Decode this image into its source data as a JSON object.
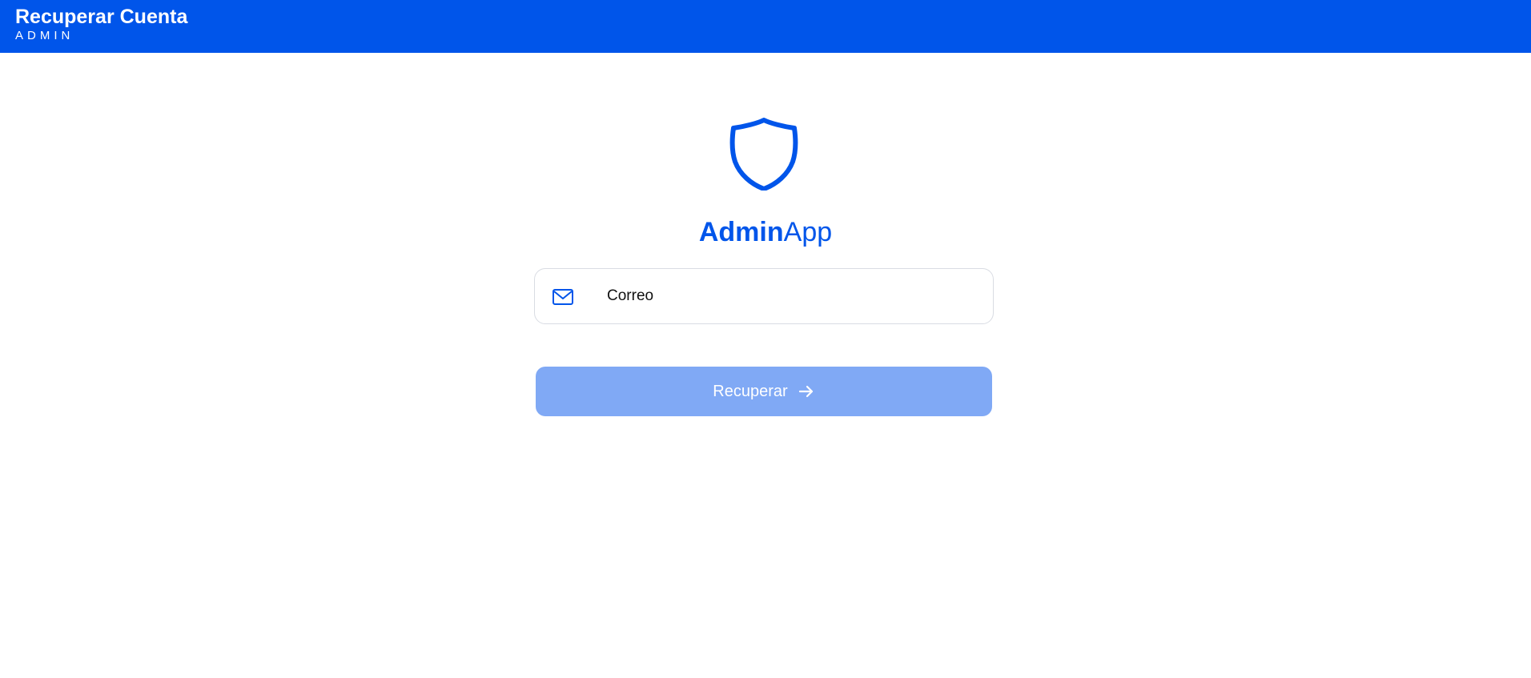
{
  "header": {
    "title": "Recuperar Cuenta",
    "subtitle": "ADMIN",
    "background_color": "#0055ea"
  },
  "brand": {
    "icon": "shield-icon",
    "name_bold": "Admin",
    "name_regular": "App",
    "color": "#0055ea"
  },
  "form": {
    "email": {
      "icon": "mail-icon",
      "label": "Correo"
    },
    "submit": {
      "label": "Recuperar",
      "icon": "arrow-right-icon",
      "background_color": "#80a9f5"
    }
  }
}
